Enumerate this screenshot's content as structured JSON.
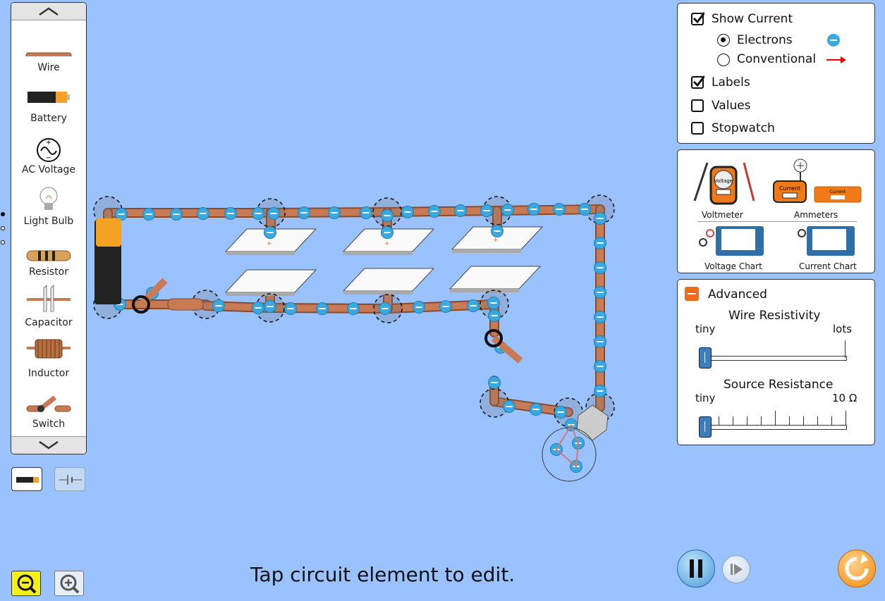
{
  "toolbox": {
    "items": [
      {
        "label": "Wire",
        "icon": "wire-icon"
      },
      {
        "label": "Battery",
        "icon": "battery-icon"
      },
      {
        "label": "AC Voltage",
        "icon": "ac-voltage-icon"
      },
      {
        "label": "Light Bulb",
        "icon": "light-bulb-icon"
      },
      {
        "label": "Resistor",
        "icon": "resistor-icon"
      },
      {
        "label": "Capacitor",
        "icon": "capacitor-icon"
      },
      {
        "label": "Inductor",
        "icon": "inductor-icon"
      },
      {
        "label": "Switch",
        "icon": "switch-icon"
      }
    ]
  },
  "display": {
    "show_current": "Show Current",
    "electrons": "Electrons",
    "conventional": "Conventional",
    "labels": "Labels",
    "values": "Values",
    "stopwatch": "Stopwatch",
    "show_current_checked": true,
    "electrons_selected": true,
    "labels_checked": true,
    "values_checked": false,
    "stopwatch_checked": false
  },
  "sensors": {
    "voltmeter": "Voltmeter",
    "ammeters": "Ammeters",
    "voltage_chart": "Voltage Chart",
    "current_chart": "Current Chart",
    "voltmeter_screen": "Voltage",
    "ammeter_screen": "Current",
    "ammeter_probe_screen": "Current"
  },
  "advanced": {
    "title": "Advanced",
    "wire_resistivity": {
      "label": "Wire Resistivity",
      "min": "tiny",
      "max": "lots",
      "value": 0
    },
    "source_resistance": {
      "label": "Source Resistance",
      "min": "tiny",
      "max": "10 Ω",
      "value": 0
    }
  },
  "status_text": "Tap circuit element to edit.",
  "colors": {
    "background": "#99c2ff",
    "wire": "#c87a55",
    "electron": "#3aa9e0",
    "accent_orange": "#f06a1a"
  }
}
